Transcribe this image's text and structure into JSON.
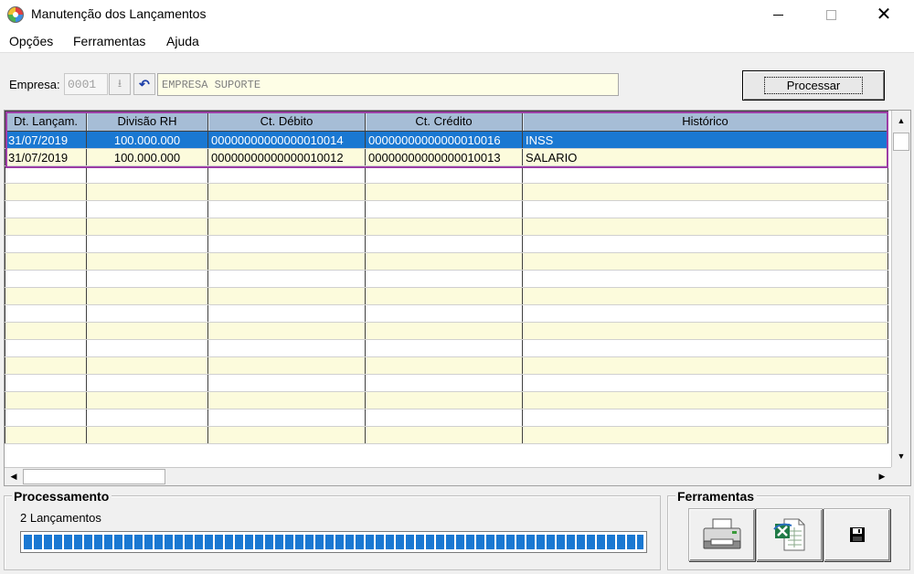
{
  "window": {
    "title": "Manutenção dos Lançamentos",
    "controls": [
      "minimize-icon",
      "maximize-icon",
      "close-icon"
    ]
  },
  "menu": {
    "items": [
      "Opções",
      "Ferramentas",
      "Ajuda"
    ]
  },
  "empresa": {
    "label": "Empresa:",
    "code": "0001",
    "name": "EMPRESA SUPORTE",
    "processar_label": "Processar"
  },
  "grid": {
    "columns": [
      "Dt. Lançam.",
      "Divisão RH",
      "Ct. Débito",
      "Ct. Crédito",
      "Histórico"
    ],
    "rows": [
      {
        "date": "31/07/2019",
        "divisao": "100.000.000",
        "debito": "00000000000000010014",
        "credito": "00000000000000010016",
        "historico": "INSS",
        "selected": true
      },
      {
        "date": "31/07/2019",
        "divisao": "100.000.000",
        "debito": "00000000000000010012",
        "credito": "00000000000000010013",
        "historico": "SALARIO",
        "selected": false
      }
    ],
    "highlight_color": "#9c3da6",
    "selection_color": "#1a78d2",
    "header_color": "#a6bdd6",
    "stripe_color": "#fcfbdc"
  },
  "processamento": {
    "title": "Processamento",
    "status": "2 Lançamentos",
    "progress": 1.0
  },
  "ferramentas": {
    "title": "Ferramentas",
    "buttons": [
      "printer-icon",
      "excel-export-icon",
      "save-icon"
    ]
  }
}
